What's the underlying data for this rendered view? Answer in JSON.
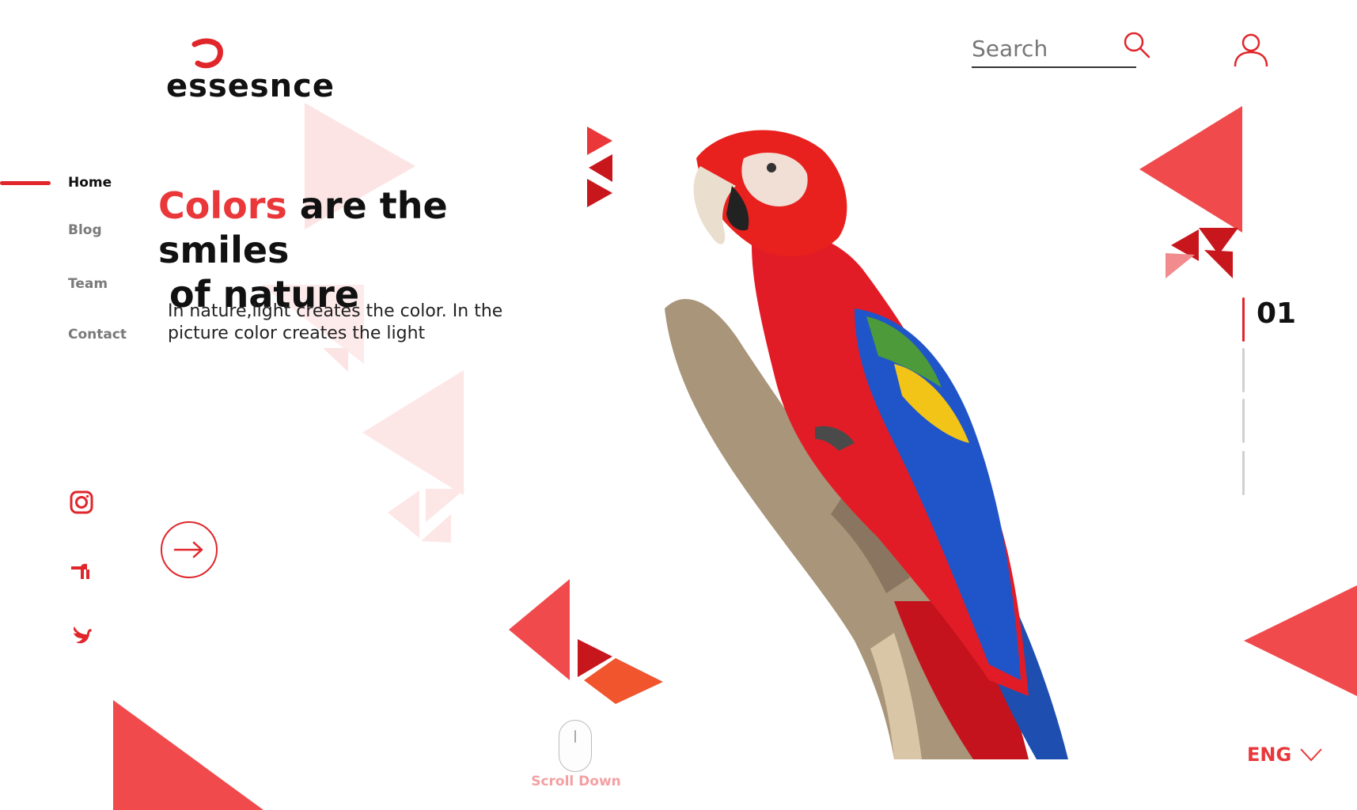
{
  "brand": {
    "name": "essesnce",
    "logo_icon": "logo-swirl-icon"
  },
  "nav": {
    "items": [
      {
        "label": "Home",
        "active": true
      },
      {
        "label": "Blog",
        "active": false
      },
      {
        "label": "Team",
        "active": false
      },
      {
        "label": "Contact",
        "active": false
      }
    ]
  },
  "hero": {
    "headline_accent": "Colors",
    "headline_rest_1": " are the smiles",
    "headline_rest_2": "of nature",
    "subtext_1": "In nature,light creates the color. In the",
    "subtext_2": "picture color creates the light"
  },
  "search": {
    "placeholder": "Search"
  },
  "pager": {
    "current": "01",
    "total_bars": 4
  },
  "language": {
    "label": "ENG"
  },
  "scroll": {
    "label": "Scroll Down"
  },
  "social": [
    "instagram-icon",
    "facebook-icon",
    "twitter-icon"
  ],
  "colors": {
    "accent": "#e9373a",
    "accent_dark": "#c8161d",
    "accent_orange": "#f0552e",
    "light_pink": "#fce4e4"
  }
}
